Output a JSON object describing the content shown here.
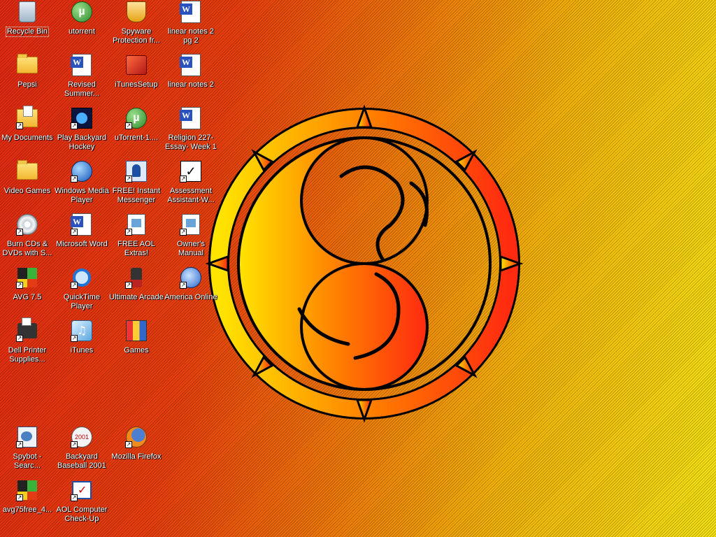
{
  "desktop": {
    "icons": [
      {
        "label": "Recycle Bin",
        "icon": "recycle-bin-icon",
        "selected": true
      },
      {
        "label": "utorrent",
        "icon": "utorrent-icon"
      },
      {
        "label": "Spyware Protection fr...",
        "icon": "spyware-protection-icon"
      },
      {
        "label": "linear notes 2 pg 2",
        "icon": "word-document-icon"
      },
      {
        "label": "Pepsi",
        "icon": "folder-icon"
      },
      {
        "label": "Revised Summer...",
        "icon": "word-document-icon"
      },
      {
        "label": "iTunesSetup",
        "icon": "setup-icon"
      },
      {
        "label": "linear notes 2",
        "icon": "word-document-icon"
      },
      {
        "label": "My Documents",
        "icon": "my-documents-icon"
      },
      {
        "label": "Play Backyard Hockey",
        "icon": "hockey-game-icon"
      },
      {
        "label": "uTorrent-1....",
        "icon": "utorrent-icon"
      },
      {
        "label": "Religion 227-Essay- Week 1",
        "icon": "word-document-icon"
      },
      {
        "label": "Video Games",
        "icon": "folder-icon"
      },
      {
        "label": "Windows Media Player",
        "icon": "media-player-icon"
      },
      {
        "label": "FREE! Instant Messenger",
        "icon": "instant-messenger-icon"
      },
      {
        "label": "Assessment Assistant-W...",
        "icon": "checklist-icon"
      },
      {
        "label": "Burn CDs & DVDs with S...",
        "icon": "cd-icon"
      },
      {
        "label": "Microsoft Word",
        "icon": "word-icon"
      },
      {
        "label": "FREE AOL Extras!",
        "icon": "aol-extras-icon"
      },
      {
        "label": "Owner's Manual",
        "icon": "manual-icon"
      },
      {
        "label": "AVG 7.5",
        "icon": "avg-icon"
      },
      {
        "label": "QuickTime Player",
        "icon": "quicktime-icon"
      },
      {
        "label": "Ultimate Arcade",
        "icon": "joystick-icon"
      },
      {
        "label": "America Online",
        "icon": "aol-icon"
      },
      {
        "label": "Dell Printer Supplies...",
        "icon": "printer-icon"
      },
      {
        "label": "iTunes",
        "icon": "itunes-icon"
      },
      {
        "label": "Games",
        "icon": "games-icon"
      },
      {
        "label": "Spybot - Searc...",
        "icon": "spybot-icon"
      },
      {
        "label": "Backyard Baseball 2001",
        "icon": "baseball-icon"
      },
      {
        "label": "Mozilla Firefox",
        "icon": "firefox-icon"
      },
      {
        "label": "avg75free_4...",
        "icon": "avg-icon"
      },
      {
        "label": "AOL Computer Check-Up",
        "icon": "aol-checkup-icon"
      }
    ]
  },
  "wallpaper": {
    "description": "",
    "colors": {
      "left": "#e42a12",
      "middle": "#f07a0a",
      "right": "#f6e414"
    }
  }
}
